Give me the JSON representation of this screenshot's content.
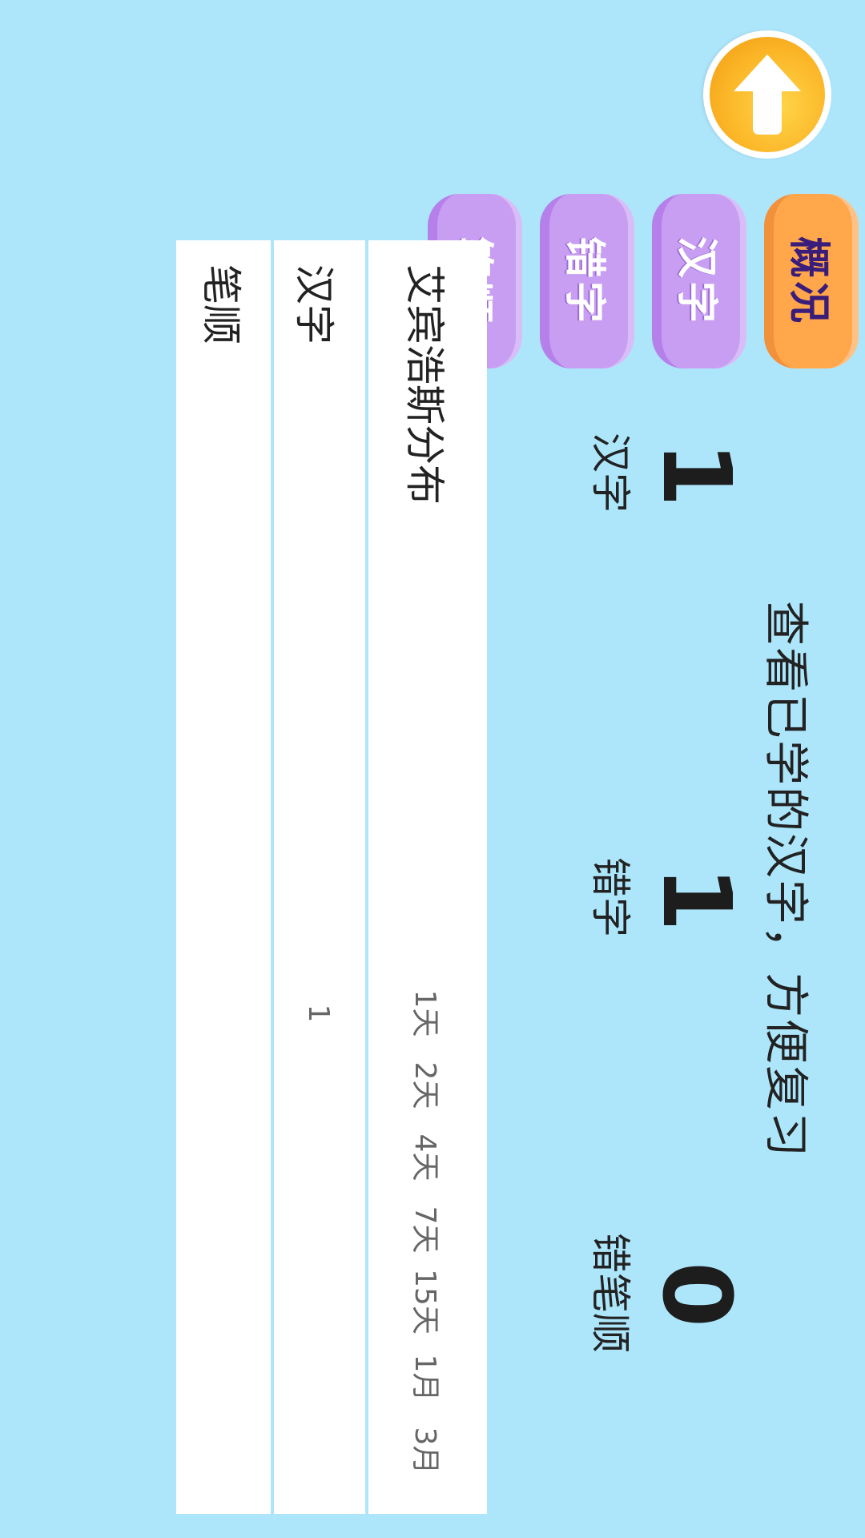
{
  "tabs": [
    {
      "label": "概况",
      "active": true
    },
    {
      "label": "汉字",
      "active": false
    },
    {
      "label": "错字",
      "active": false
    },
    {
      "label": "笔顺",
      "active": false
    }
  ],
  "headline": "查看已学的汉字，方便复习",
  "stats": [
    {
      "value": "1",
      "label": "汉字"
    },
    {
      "value": "1",
      "label": "错字"
    },
    {
      "value": "0",
      "label": "错笔顺"
    }
  ],
  "table": {
    "title": "艾宾浩斯分布",
    "intervals": [
      "1天",
      "2天",
      "4天",
      "7天",
      "15天",
      "1月",
      "3月"
    ],
    "rows": [
      {
        "label": "汉字",
        "values": [
          "1",
          "",
          "",
          "",
          "",
          "",
          ""
        ]
      },
      {
        "label": "笔顺",
        "values": [
          "",
          "",
          "",
          "",
          "",
          "",
          ""
        ]
      }
    ]
  },
  "colors": {
    "background": "#ade6fb",
    "tab_active": "#ffa74a",
    "tab_inactive": "#c89ef2",
    "back_button": "#fbb627"
  },
  "icons": {
    "back": "arrow-up-icon"
  }
}
